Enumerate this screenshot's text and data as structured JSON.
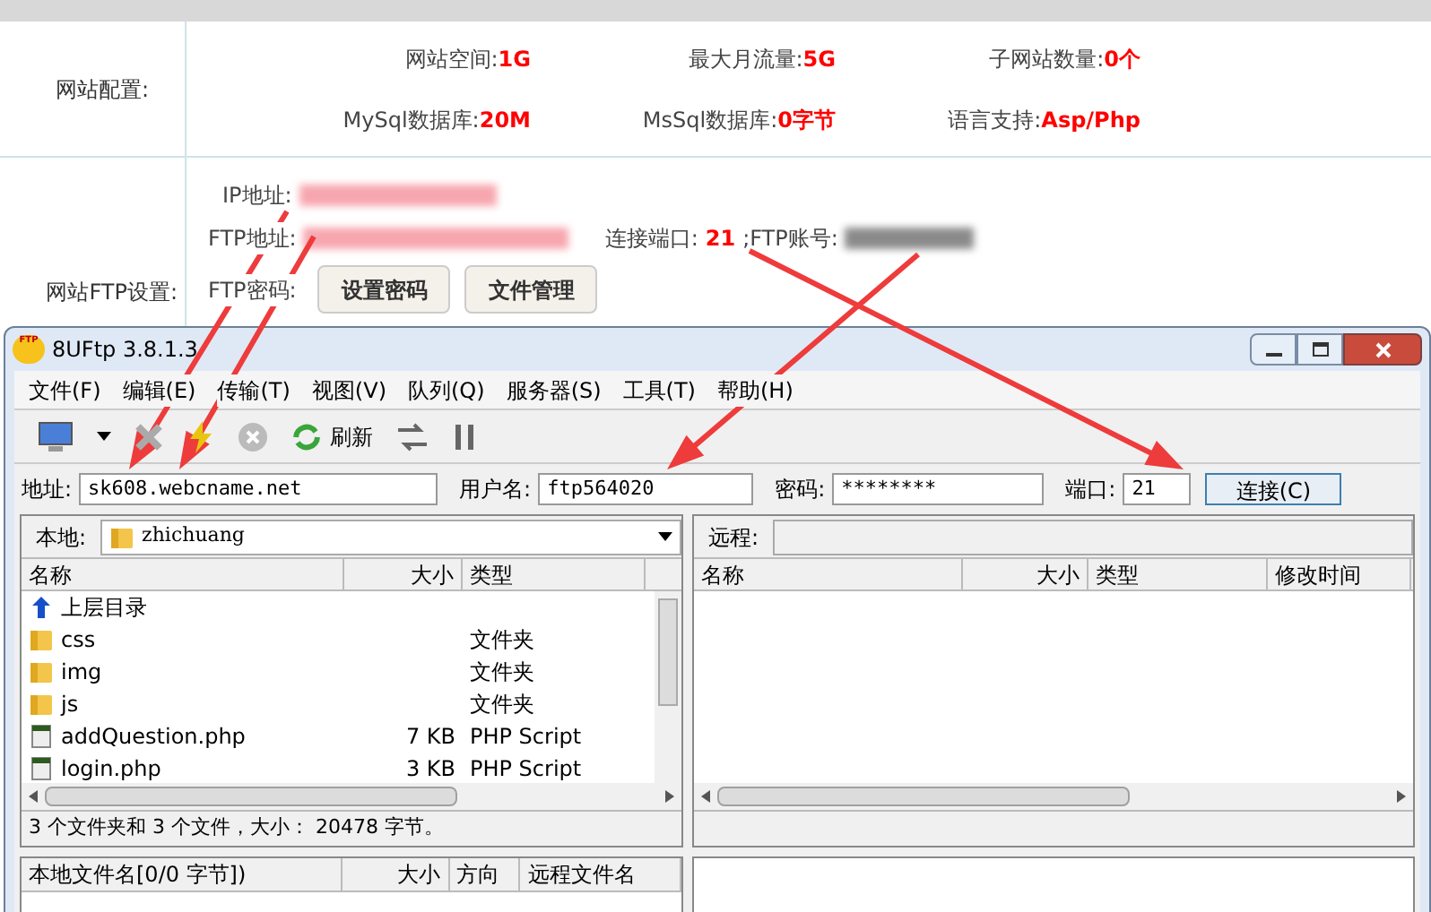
{
  "web_panel": {
    "config_label": "网站配置:",
    "config_items": [
      {
        "label": "网站空间:",
        "value": "1G"
      },
      {
        "label": "最大月流量:",
        "value": "5G"
      },
      {
        "label": "子网站数量:",
        "value": "0个"
      },
      {
        "label": "MySql数据库:",
        "value": "20M"
      },
      {
        "label": "MsSql数据库:",
        "value": "0字节"
      },
      {
        "label": "语言支持:",
        "value": "Asp/Php"
      }
    ],
    "ftp_label": "网站FTP设置:",
    "ip_label": "IP地址:",
    "ftp_address_label": "FTP地址:",
    "port_label": "连接端口:",
    "port_value": "21",
    "account_label": ";FTP账号:",
    "password_label": "FTP密码:",
    "buttons": [
      "设置密码",
      "文件管理"
    ]
  },
  "window": {
    "title": "8UFtp 3.8.1.3",
    "logo_text": "FTP"
  },
  "menu": [
    "文件(F)",
    "编辑(E)",
    "传输(T)",
    "视图(V)",
    "队列(Q)",
    "服务器(S)",
    "工具(T)",
    "帮助(H)"
  ],
  "toolbar": {
    "refresh_label": "刷新"
  },
  "connection": {
    "fields": [
      {
        "label": "地址:",
        "value": "sk608.webcname.net"
      },
      {
        "label": "用户名:",
        "value": "ftp564020"
      },
      {
        "label": "密码:",
        "value": "********"
      },
      {
        "label": "端口:",
        "value": "21"
      }
    ],
    "connect_button": "连接(C)"
  },
  "local": {
    "label": "本地:",
    "path": "zhichuang",
    "columns": [
      "名称",
      "大小",
      "类型"
    ],
    "rows": [
      {
        "kind": "up",
        "name": "上层目录",
        "size": "",
        "type": ""
      },
      {
        "kind": "folder",
        "name": "css",
        "size": "",
        "type": "文件夹"
      },
      {
        "kind": "folder",
        "name": "img",
        "size": "",
        "type": "文件夹"
      },
      {
        "kind": "folder",
        "name": "js",
        "size": "",
        "type": "文件夹"
      },
      {
        "kind": "file",
        "name": "addQuestion.php",
        "size": "7 KB",
        "type": "PHP Script"
      },
      {
        "kind": "file",
        "name": "login.php",
        "size": "3 KB",
        "type": "PHP Script"
      }
    ],
    "status": "3 个文件夹和 3 个文件，大小： 20478 字节。"
  },
  "remote": {
    "label": "远程:",
    "columns": [
      "名称",
      "大小",
      "类型",
      "修改时间"
    ]
  },
  "queue": {
    "columns": [
      "本地文件名[0/0 字节])",
      "大小",
      "方向",
      "远程文件名"
    ]
  }
}
